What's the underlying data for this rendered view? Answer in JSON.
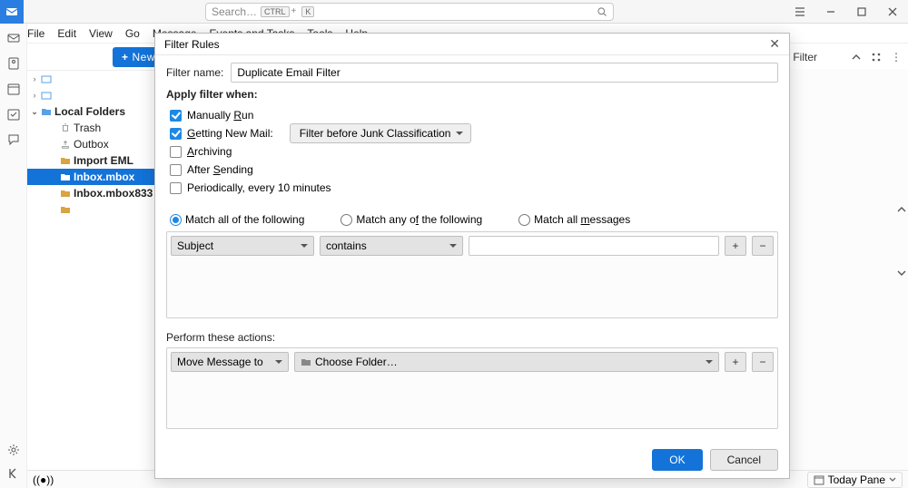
{
  "titlebar": {
    "search_placeholder": "Search…",
    "kbd1": "CTRL",
    "kbd_sep": "+",
    "kbd2": "K"
  },
  "menubar": [
    "File",
    "Edit",
    "View",
    "Go",
    "Message",
    "Events and Tasks",
    "Tools",
    "Help"
  ],
  "toolbar": {
    "new_label": "New M",
    "quick_filter": "Quick Filter"
  },
  "tree": {
    "account1": " ",
    "account2": " ",
    "local_folders": "Local Folders",
    "trash": "Trash",
    "outbox": "Outbox",
    "import_eml": "Import EML",
    "inbox_mbox": "Inbox.mbox",
    "inbox_mbox833": "Inbox.mbox833",
    "last": " "
  },
  "statusbar": {
    "left": "((●))",
    "today_pane": "Today Pane"
  },
  "dialog": {
    "title": "Filter Rules",
    "filter_name_label": "Filter name:",
    "filter_name_value": "Duplicate Email Filter",
    "apply_when": "Apply filter when:",
    "cb_manual": "Manually Run",
    "cb_getting": "Getting New Mail:",
    "timing_select": "Filter before Junk Classification",
    "cb_archiving": "Archiving",
    "cb_after": "After Sending",
    "cb_periodic": "Periodically, every 10 minutes",
    "radio_all": "Match all of the following",
    "radio_any": "Match any of the following",
    "radio_msgs": "Match all messages",
    "cond_field": "Subject",
    "cond_op": "contains",
    "perform": "Perform these actions:",
    "action": "Move Message to",
    "choose_folder": "Choose Folder…",
    "ok": "OK",
    "cancel": "Cancel",
    "plus": "+",
    "minus": "−"
  }
}
